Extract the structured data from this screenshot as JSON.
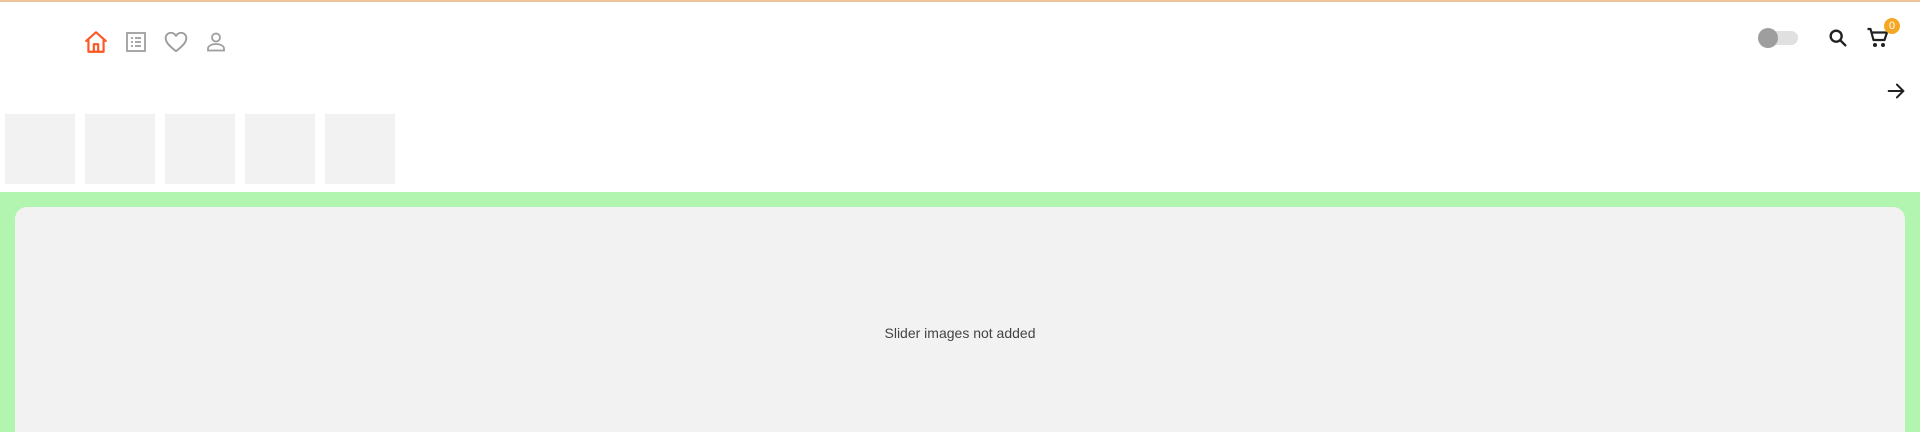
{
  "colors": {
    "accent": "#ff5722",
    "icon_gray": "#9e9e9e",
    "badge": "#f5a623",
    "slider_band": "#b2f5b0",
    "placeholder": "#f2f2f2"
  },
  "nav": {
    "left_icons": [
      "home-icon",
      "catalog-list-icon",
      "heart-icon",
      "user-icon"
    ],
    "active": "home-icon"
  },
  "header_right": {
    "theme_toggle": "off",
    "icons": [
      "search-icon",
      "cart-icon"
    ],
    "cart_count": "0"
  },
  "categories": {
    "tile_count": 5,
    "next_icon": "arrow-right-icon"
  },
  "slider": {
    "message": "Slider images not added"
  }
}
